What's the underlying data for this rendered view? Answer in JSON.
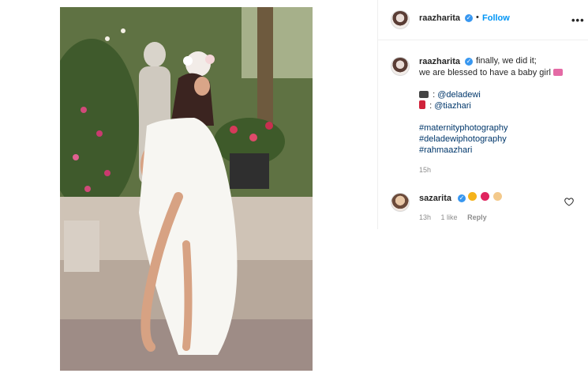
{
  "header": {
    "username": "raazharita",
    "dot": "•",
    "follow_label": "Follow",
    "more_label": "•••"
  },
  "caption": {
    "username": "raazharita",
    "line1": "finally, we did it;",
    "line2": "we are blessed to have a baby girl",
    "camera_credit": "@deladewi",
    "lipstick_credit": "@tiazhari",
    "hashtags": [
      "#maternityphotography",
      "#deladewiphotography",
      "#rahmaazhari"
    ],
    "time": "15h"
  },
  "comment": {
    "username": "sazarita",
    "time": "13h",
    "likes": "1 like",
    "reply_label": "Reply"
  },
  "icons": {
    "verified": "verified-badge-icon",
    "heart": "heart-outline-icon",
    "more": "more-options-icon",
    "camera": "camera-emoji",
    "lipstick": "lipstick-emoji",
    "bow": "ribbon-emoji"
  },
  "colors": {
    "follow": "#0095f6",
    "verified": "#3897f0",
    "hashtag": "#00376b",
    "meta": "#8e8e8e"
  }
}
